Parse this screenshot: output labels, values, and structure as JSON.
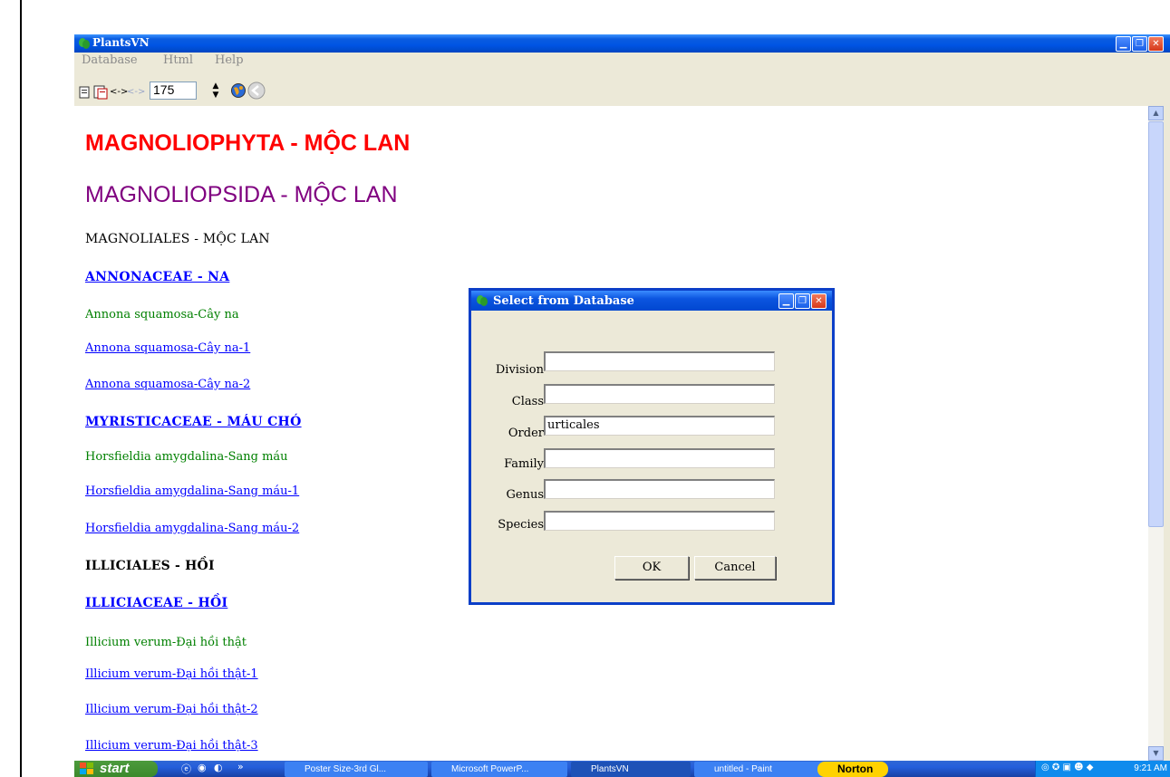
{
  "window": {
    "title": "PlantsVN",
    "menu": [
      "Database",
      "Html",
      "Help"
    ],
    "toolbar": {
      "number_value": "175"
    }
  },
  "content": {
    "division": "MAGNOLIOPHYTA - MỘC LAN",
    "class": "MAGNOLIOPSIDA - MỘC LAN",
    "order1": "MAGNOLIALES - MỘC LAN",
    "family1": "ANNONACEAE - NA",
    "items1": [
      {
        "text": "Annona squamosa-Cây na",
        "style": "species"
      },
      {
        "text": "Annona squamosa-Cây na-1",
        "style": "link"
      },
      {
        "text": "Annona squamosa-Cây na-2",
        "style": "link"
      }
    ],
    "family2": "MYRISTICACEAE - MÁU CHÓ",
    "items2": [
      {
        "text": "Horsfieldia amygdalina-Sang máu",
        "style": "species"
      },
      {
        "text": "Horsfieldia amygdalina-Sang máu-1",
        "style": "link"
      },
      {
        "text": "Horsfieldia amygdalina-Sang máu-2",
        "style": "link"
      }
    ],
    "order2": "ILLICIALES - HỒI",
    "family3": "ILLICIACEAE - HỒI",
    "items3": [
      {
        "text": "Illicium verum-Đại hồi thật",
        "style": "species"
      },
      {
        "text": "Illicium verum-Đại hồi thật-1",
        "style": "link"
      },
      {
        "text": "Illicium verum-Đại hồi thật-2",
        "style": "link"
      },
      {
        "text": "Illicium verum-Đại hồi thật-3",
        "style": "link"
      }
    ]
  },
  "dialog": {
    "title": "Select from Database",
    "fields": [
      {
        "label": "Division",
        "value": ""
      },
      {
        "label": "Class",
        "value": ""
      },
      {
        "label": "Order",
        "value": "urticales"
      },
      {
        "label": "Family",
        "value": ""
      },
      {
        "label": "Genus",
        "value": ""
      },
      {
        "label": "Species",
        "value": ""
      }
    ],
    "ok_label": "OK",
    "cancel_label": "Cancel"
  },
  "taskbar": {
    "start_label": "start",
    "buttons": [
      "Poster Size-3rd Gl...",
      "Microsoft PowerP...",
      "PlantsVN",
      "untitled - Paint"
    ],
    "norton_label": "Norton",
    "clock": "9:21 AM"
  },
  "colors": {
    "division": "#ff0000",
    "class": "#800080",
    "species": "#008000",
    "link": "#0000ff",
    "xp_blue": "#0054e3"
  }
}
